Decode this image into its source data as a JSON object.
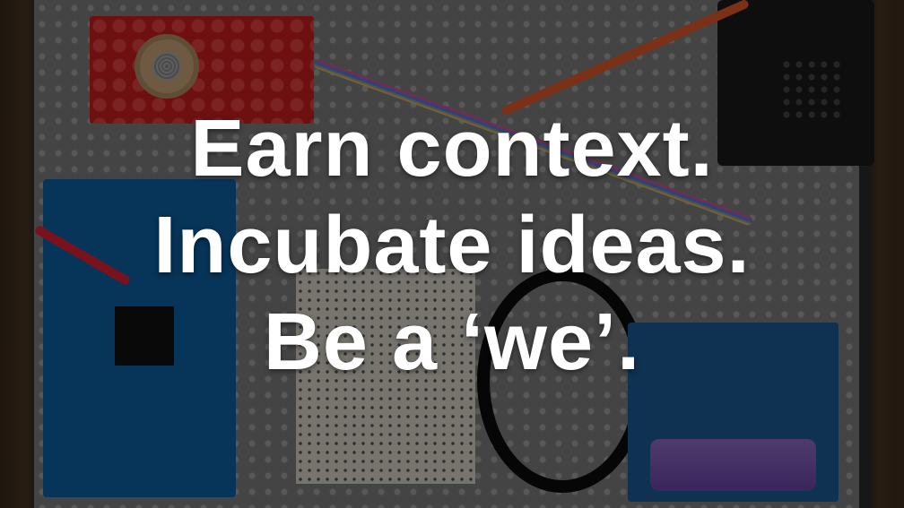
{
  "caption": {
    "line1": "Earn context.",
    "line2": "Incubate ideas.",
    "line3": "Be a ‘we’."
  },
  "photo": {
    "colors": {
      "overlay": "#000000",
      "lego_plate": "#7d7d7d",
      "lego_brick": "#c81e1e",
      "arduino_board": "#0e5fa3",
      "battery": "#7a55b6",
      "text": "#ffffff"
    }
  }
}
